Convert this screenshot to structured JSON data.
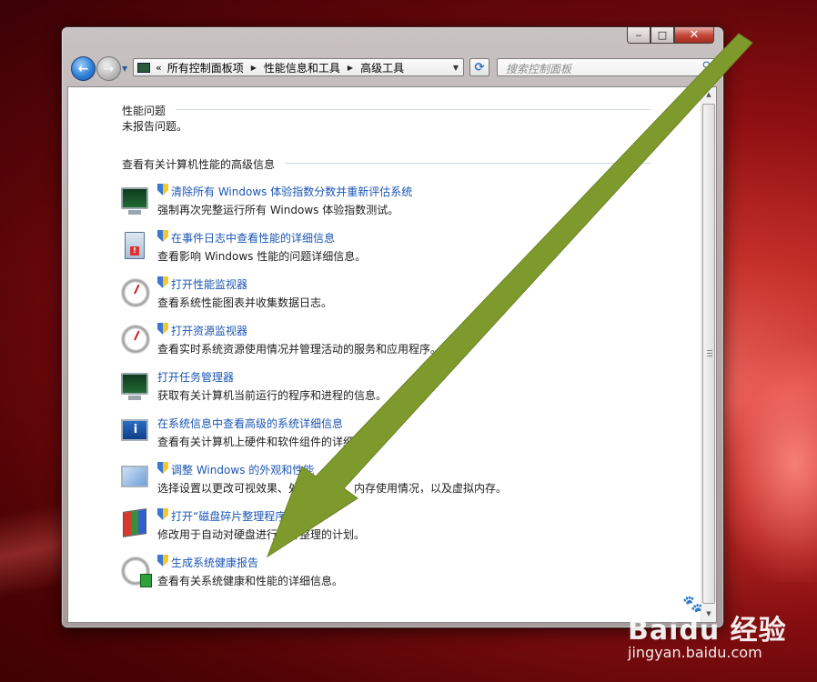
{
  "window": {
    "caption": {
      "minimize": "‒",
      "maximize": "□",
      "close": "✕"
    }
  },
  "navbar": {
    "back_icon": "←",
    "forward_icon": "→",
    "recent_icon": "▼",
    "breadcrumb_prefix": "«",
    "breadcrumb": [
      "所有控制面板项",
      "性能信息和工具",
      "高级工具"
    ],
    "separator": "▶",
    "dropdown_icon": "▼",
    "refresh_icon": "⟳",
    "search_placeholder": "搜索控制面板",
    "search_icon": "⚲"
  },
  "scrollbar": {
    "up_icon": "▲",
    "down_icon": "▼"
  },
  "performance_issues": {
    "heading": "性能问题",
    "status": "未报告问题。"
  },
  "advanced": {
    "heading": "查看有关计算机性能的高级信息",
    "tasks": [
      {
        "icon": "monitor-icon",
        "shield": true,
        "link": "清除所有 Windows 体验指数分数并重新评估系统",
        "desc": "强制再次完整运行所有 Windows 体验指数测试。"
      },
      {
        "icon": "event-log-icon",
        "shield": true,
        "link": "在事件日志中查看性能的详细信息",
        "desc": "查看影响 Windows 性能的问题详细信息。"
      },
      {
        "icon": "gauge-icon",
        "shield": true,
        "link": "打开性能监视器",
        "desc": "查看系统性能图表并收集数据日志。"
      },
      {
        "icon": "gauge-icon",
        "shield": true,
        "link": "打开资源监视器",
        "desc": "查看实时系统资源使用情况并管理活动的服务和应用程序。"
      },
      {
        "icon": "monitor-icon",
        "shield": false,
        "link": "打开任务管理器",
        "desc": "获取有关计算机当前运行的程序和进程的信息。"
      },
      {
        "icon": "system-info-icon",
        "shield": false,
        "link": "在系统信息中查看高级的系统详细信息",
        "desc": "查看有关计算机上硬件和软件组件的详细信息。"
      },
      {
        "icon": "visual-effects-icon",
        "shield": true,
        "link": "调整 Windows 的外观和性能",
        "desc": "选择设置以更改可视效果、处理器调度、内存使用情况，以及虚拟内存。"
      },
      {
        "icon": "defrag-icon",
        "shield": true,
        "link": "打开“磁盘碎片整理程序”",
        "desc": "修改用于自动对硬盘进行碎片整理的计划。"
      },
      {
        "icon": "health-report-icon",
        "shield": true,
        "link": "生成系统健康报告",
        "desc": "查看有关系统健康和性能的详细信息。"
      }
    ]
  },
  "watermark": {
    "logo": "Baidu 经验",
    "url": "jingyan.baidu.com"
  },
  "colors": {
    "link": "#1a56b4",
    "arrow": "#7f9a2c",
    "desktop": "#8e0f12"
  }
}
